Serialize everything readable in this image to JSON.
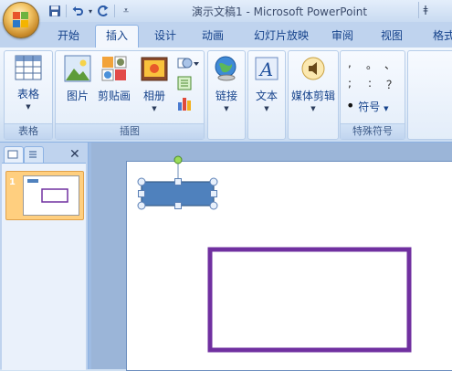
{
  "window": {
    "title": "演示文稿1 - Microsoft PowerPoint",
    "right_glyph": "ǂ"
  },
  "colors": {
    "accent": "#15428b",
    "shape_fill": "#4f81bd",
    "rect_border": "#7030a0",
    "selected_slide": "#ffcf7f"
  },
  "quick_access": {
    "save": "save-icon",
    "undo": "undo-icon",
    "redo": "redo-icon",
    "customize": "▾"
  },
  "tabs": [
    {
      "label": "开始"
    },
    {
      "label": "插入"
    },
    {
      "label": "设计"
    },
    {
      "label": "动画"
    },
    {
      "label": "幻灯片放映"
    },
    {
      "label": "审阅"
    },
    {
      "label": "视图"
    },
    {
      "label": "格式"
    }
  ],
  "ribbon": {
    "groups": {
      "table": {
        "label": "表格",
        "buttons": {
          "table": "表格"
        }
      },
      "illustrations": {
        "label": "插图",
        "buttons": {
          "picture": "图片",
          "clipart": "剪贴画",
          "album": "相册"
        }
      },
      "links": {
        "buttons": {
          "link": "链接"
        }
      },
      "text": {
        "buttons": {
          "text": "文本"
        }
      },
      "media": {
        "buttons": {
          "media": "媒体剪辑"
        }
      },
      "symbols": {
        "label": "特殊符号",
        "symbols": [
          ",",
          "。",
          "、",
          ";",
          ":",
          "？"
        ],
        "bullet": "•",
        "symbol_button": "符号"
      }
    }
  },
  "slides_pane": {
    "slides": [
      {
        "number": "1"
      }
    ],
    "close": "✕"
  }
}
